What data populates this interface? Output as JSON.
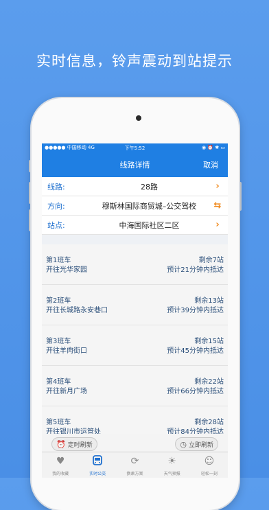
{
  "headline": "实时信息，铃声震动到站提示",
  "status": {
    "carrier": "●●●●● 中国移动 4G",
    "time": "下午5:52",
    "right": "◉ ⏰ ✱ ▭"
  },
  "nav": {
    "title": "线路详情",
    "cancel": "取消"
  },
  "info": {
    "route_label": "线路:",
    "route_value": "28路",
    "direction_label": "方向:",
    "direction_value": "穆斯林国际商贸城–公交驾校",
    "station_label": "站点:",
    "station_value": "中海国际社区二区"
  },
  "buses": [
    {
      "name": "第1班车",
      "dest": "开往光华家园",
      "remaining": "剩余7站",
      "eta": "预计21分钟内抵达"
    },
    {
      "name": "第2班车",
      "dest": "开往长城路永安巷口",
      "remaining": "剩余13站",
      "eta": "预计39分钟内抵达"
    },
    {
      "name": "第3班车",
      "dest": "开往羊肉街口",
      "remaining": "剩余15站",
      "eta": "预计45分钟内抵达"
    },
    {
      "name": "第4班车",
      "dest": "开往新月广场",
      "remaining": "剩余22站",
      "eta": "预计66分钟内抵达"
    },
    {
      "name": "第5班车",
      "dest": "开往银川市运管处",
      "remaining": "剩余28站",
      "eta": "预计84分钟内抵达"
    }
  ],
  "refresh": {
    "timed": "定时刷新",
    "now": "立即刷新"
  },
  "tabs": [
    {
      "label": "我的收藏",
      "icon": "heart-icon"
    },
    {
      "label": "实时公交",
      "icon": "bus-icon"
    },
    {
      "label": "换乘方案",
      "icon": "transfer-icon"
    },
    {
      "label": "天气预报",
      "icon": "sun-icon"
    },
    {
      "label": "轻松一刻",
      "icon": "smile-icon"
    }
  ],
  "colors": {
    "background": "#4a8fe6",
    "navbar": "#1f7fe3",
    "accent_orange": "#f08a1e",
    "label_blue": "#1f70cf"
  }
}
